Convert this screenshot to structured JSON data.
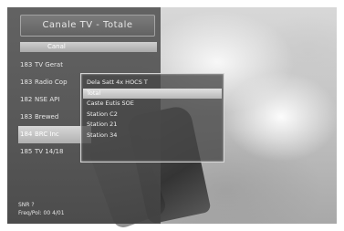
{
  "panel": {
    "title": "Canale TV - Totale",
    "group": "Canal",
    "channels": [
      {
        "num": "183",
        "name": "TV Gerat"
      },
      {
        "num": "183",
        "name": "Radio Cop"
      },
      {
        "num": "182",
        "name": "NSE API"
      },
      {
        "num": "183",
        "name": "Brewed"
      },
      {
        "num": "184",
        "name": "BRC Inc"
      },
      {
        "num": "185",
        "name": "TV 14/18"
      }
    ],
    "selected_channel_index": 4,
    "info_line1": "SNR ?",
    "info_line2": "Freq/Pol: 00 4/01"
  },
  "popup": {
    "items": [
      "Dela Satt 4x HOCS T",
      "Total",
      "Caste Eutis SOE",
      "Station C2",
      "Station 21",
      "Station 34"
    ],
    "selected_index": 1
  }
}
